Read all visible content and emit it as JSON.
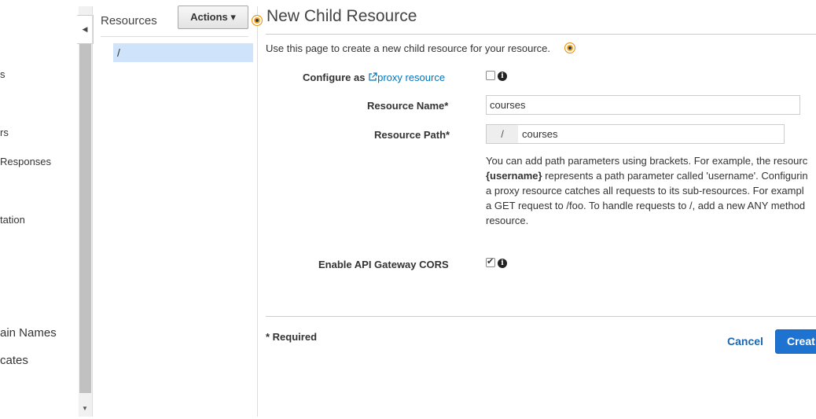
{
  "nav": {
    "items": [
      "s",
      "rs",
      "Responses",
      "tation",
      "ain Names",
      "cates"
    ]
  },
  "resources_panel": {
    "title": "Resources",
    "actions_label": "Actions ▾",
    "root_path": "/"
  },
  "form": {
    "title": "New Child Resource",
    "intro": "Use this page to create a new child resource for your resource.",
    "configure_label": "Configure as",
    "proxy_link": "proxy resource",
    "proxy_checked": false,
    "resource_name_label": "Resource Name*",
    "resource_name_value": "courses",
    "resource_path_label": "Resource Path*",
    "path_prefix": "/",
    "resource_path_value": "courses",
    "help_lines": [
      "You can add path parameters using brackets. For example, the resourc",
      "{username} represents a path parameter called 'username'. Configurin",
      "a proxy resource catches all requests to its sub-resources. For exampl",
      "a GET request to /foo. To handle requests to /, add a new ANY method",
      "resource."
    ],
    "cors_label": "Enable API Gateway CORS",
    "cors_checked": true,
    "required_note": "* Required",
    "cancel_label": "Cancel",
    "create_label": "Creat"
  },
  "colors": {
    "accent": "#1f73d0",
    "link": "#0073bb",
    "selected_row": "#cfe3fb",
    "highlight_dot": "#f5a623"
  },
  "icons": [
    "collapse-left-icon",
    "external-link-icon",
    "info-icon",
    "scroll-down-icon"
  ]
}
